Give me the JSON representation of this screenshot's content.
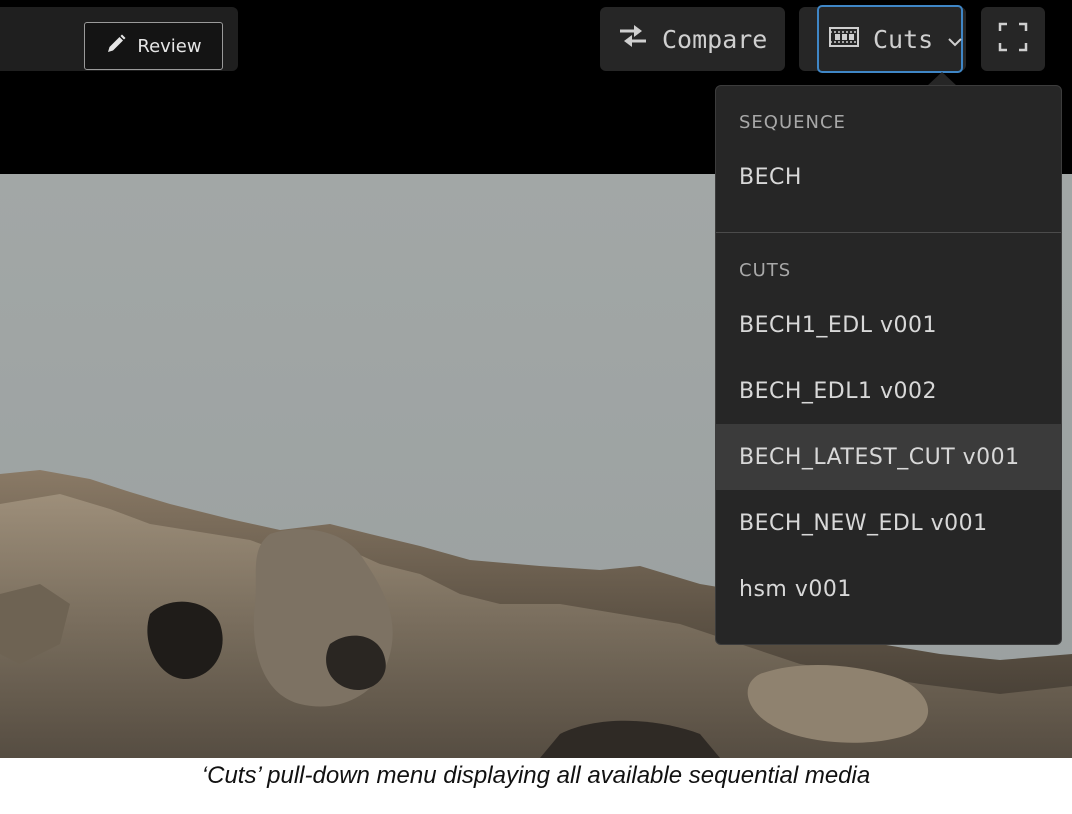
{
  "toolbar": {
    "review_label": "Review",
    "compare_label": "Compare",
    "cuts_label": "Cuts",
    "icons": [
      "pencil-icon",
      "swap-arrows-icon",
      "film-strip-icon",
      "chevron-down-icon",
      "fullscreen-icon"
    ]
  },
  "menu": {
    "sequence_header": "SEQUENCE",
    "sequence_items": [
      "BECH"
    ],
    "cuts_header": "CUTS",
    "cuts_items": [
      "BECH1_EDL v001",
      "BECH_EDL1 v002",
      "BECH_LATEST_CUT v001",
      "BECH_NEW_EDL v001",
      "hsm v001"
    ],
    "highlighted_item": "BECH_LATEST_CUT v001"
  },
  "caption": "‘Cuts’ pull-down menu displaying all available sequential media",
  "colors": {
    "background": "#000000",
    "menu_background": "#262626",
    "accent_border": "#3f86c6",
    "highlight_row": "#3b3b3b"
  }
}
